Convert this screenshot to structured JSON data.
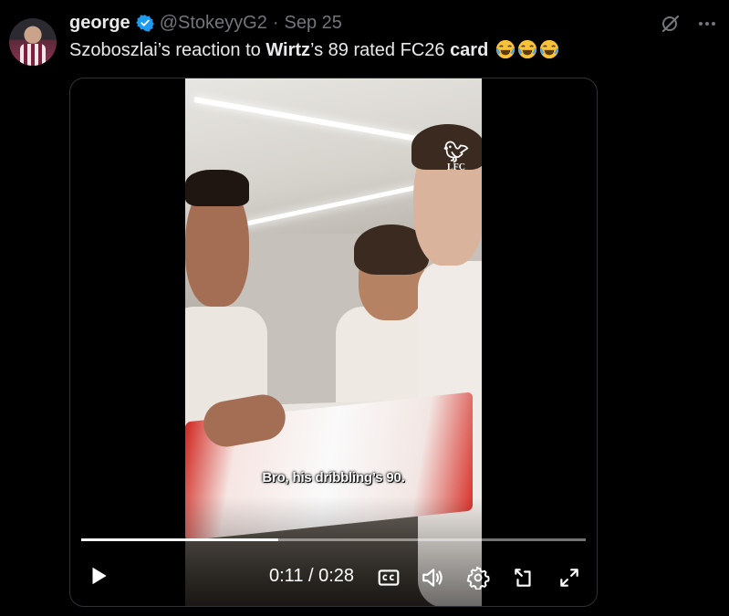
{
  "tweet": {
    "author_name": "george",
    "handle": "@StokeyyG2",
    "separator": "·",
    "date": "Sep 25",
    "text_parts": {
      "p1": "Szoboszlai’s reaction to ",
      "b1": "Wirtz",
      "p2": "’s 89 rated FC26 ",
      "b2": "card",
      "p3": " "
    },
    "emoji": [
      "joy-emoji",
      "joy-emoji",
      "joy-emoji"
    ]
  },
  "top_actions": {
    "icons": [
      "grok-icon",
      "more-icon"
    ]
  },
  "video": {
    "subtitle": "Bro, his dribbling’s 90.",
    "overlay_logo": {
      "crest": "Liverbird",
      "text": "LFC"
    },
    "current_time": "0:11",
    "time_separator": " / ",
    "duration": "0:28",
    "progress_fraction": 0.39,
    "controls": [
      "play-icon",
      "closed-captions-icon",
      "volume-icon",
      "settings-icon",
      "pip-icon",
      "fullscreen-icon"
    ]
  },
  "colors": {
    "background": "#000000",
    "text": "#e7e9ea",
    "muted": "#71767b",
    "verified": "#1d9bf0",
    "border": "#2f3336"
  }
}
